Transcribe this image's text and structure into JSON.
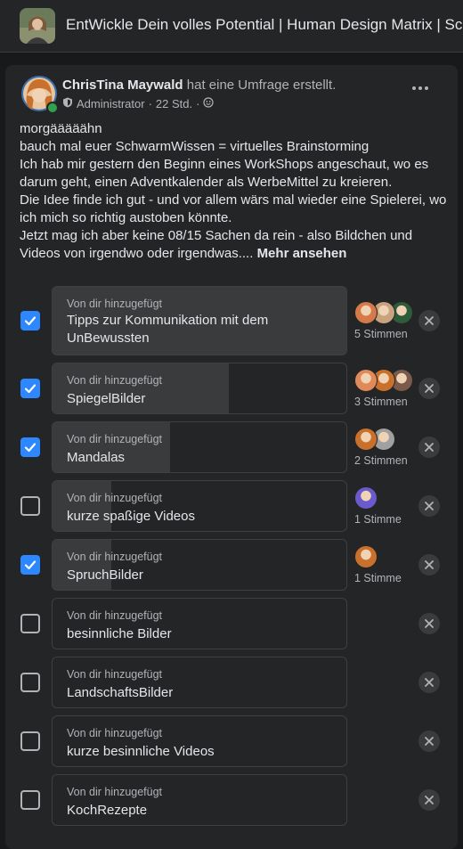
{
  "group": {
    "title": "EntWickle Dein volles Potential | Human Design Matrix | Scan"
  },
  "post": {
    "author": "ChrisTina Maywald",
    "action": "hat eine Umfrage erstellt.",
    "role": "Administrator",
    "time": "22 Std.",
    "separator": "·",
    "lines": [
      "morgääääähn",
      "bauch mal euer SchwarmWissen = virtuelles Brainstorming",
      "Ich hab mir gestern den Beginn eines WorkShops angeschaut, wo es darum geht, einen Adventkalender als WerbeMittel zu kreieren.",
      "Die Idee finde ich gut - und vor allem wärs mal wieder eine Spielerei, wo ich mich so richtig austoben könnte.",
      "Jetzt mag ich aber keine 08/15 Sachen da rein - also Bildchen und Videos von irgendwo oder irgendwas...."
    ],
    "see_more": "Mehr ansehen"
  },
  "poll": {
    "added_by_label": "Von dir hinzugefügt",
    "options": [
      {
        "label": "Tipps zur Kommunikation mit dem UnBewussten",
        "checked": true,
        "votes": "5 Stimmen",
        "fill": 1.0
      },
      {
        "label": "SpiegelBilder",
        "checked": true,
        "votes": "3 Stimmen",
        "fill": 0.6
      },
      {
        "label": "Mandalas",
        "checked": true,
        "votes": "2 Stimmen",
        "fill": 0.4
      },
      {
        "label": "kurze spaßige Videos",
        "checked": false,
        "votes": "1 Stimme",
        "fill": 0.2
      },
      {
        "label": "SpruchBilder",
        "checked": true,
        "votes": "1 Stimme",
        "fill": 0.2
      },
      {
        "label": "besinnliche Bilder",
        "checked": false,
        "votes": "",
        "fill": 0
      },
      {
        "label": "LandschaftsBilder",
        "checked": false,
        "votes": "",
        "fill": 0
      },
      {
        "label": "kurze besinnliche Videos",
        "checked": false,
        "votes": "",
        "fill": 0
      },
      {
        "label": "KochRezepte",
        "checked": false,
        "votes": "",
        "fill": 0
      }
    ]
  },
  "colors": {
    "accent": "#2d88ff",
    "background": "#18191a",
    "card": "#242526",
    "fill": "#3a3b3c"
  }
}
